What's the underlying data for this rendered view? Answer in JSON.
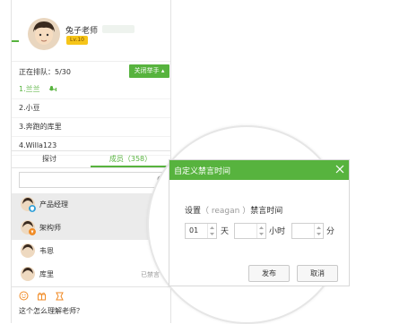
{
  "colors": {
    "accent": "#57b33e",
    "badge": "#f6c519",
    "selected_row": "#ebebeb"
  },
  "profile": {
    "name": "兔子老师",
    "level": "Lv.10"
  },
  "queue": {
    "status_label": "正在排队：5/30",
    "raise_hand_label": "关闭举手",
    "items": [
      {
        "label": "1.兰兰",
        "active": true
      },
      {
        "label": "2.小豆",
        "active": false
      },
      {
        "label": "3.奔跑的库里",
        "active": false
      },
      {
        "label": "4.Willa123",
        "active": false
      }
    ]
  },
  "tabs": {
    "discuss": "探讨",
    "members": "成员（358）"
  },
  "members": [
    {
      "name": "产品经理",
      "status": "",
      "selected": true,
      "role_icon": "shield-icon"
    },
    {
      "name": "架构师",
      "status": "",
      "selected": true,
      "role_icon": "badge-icon"
    },
    {
      "name": "韦恩",
      "status": "",
      "selected": false,
      "role_icon": ""
    },
    {
      "name": "库里",
      "status": "已禁言",
      "selected": false,
      "role_icon": ""
    }
  ],
  "toolbar": {
    "icons": [
      "smile-icon",
      "gift-icon",
      "flower-icon"
    ]
  },
  "input": {
    "text": "这个怎么理解老师？"
  },
  "dialog": {
    "title": "自定义禁言时间",
    "desc_prefix": "设置",
    "desc_user": "（ reagan ）",
    "desc_suffix": "禁言时间",
    "day_value": "01",
    "day_unit": "天",
    "hour_value": "",
    "hour_unit": "小时",
    "minute_value": "",
    "minute_unit": "分",
    "publish_label": "发布",
    "cancel_label": "取消"
  }
}
